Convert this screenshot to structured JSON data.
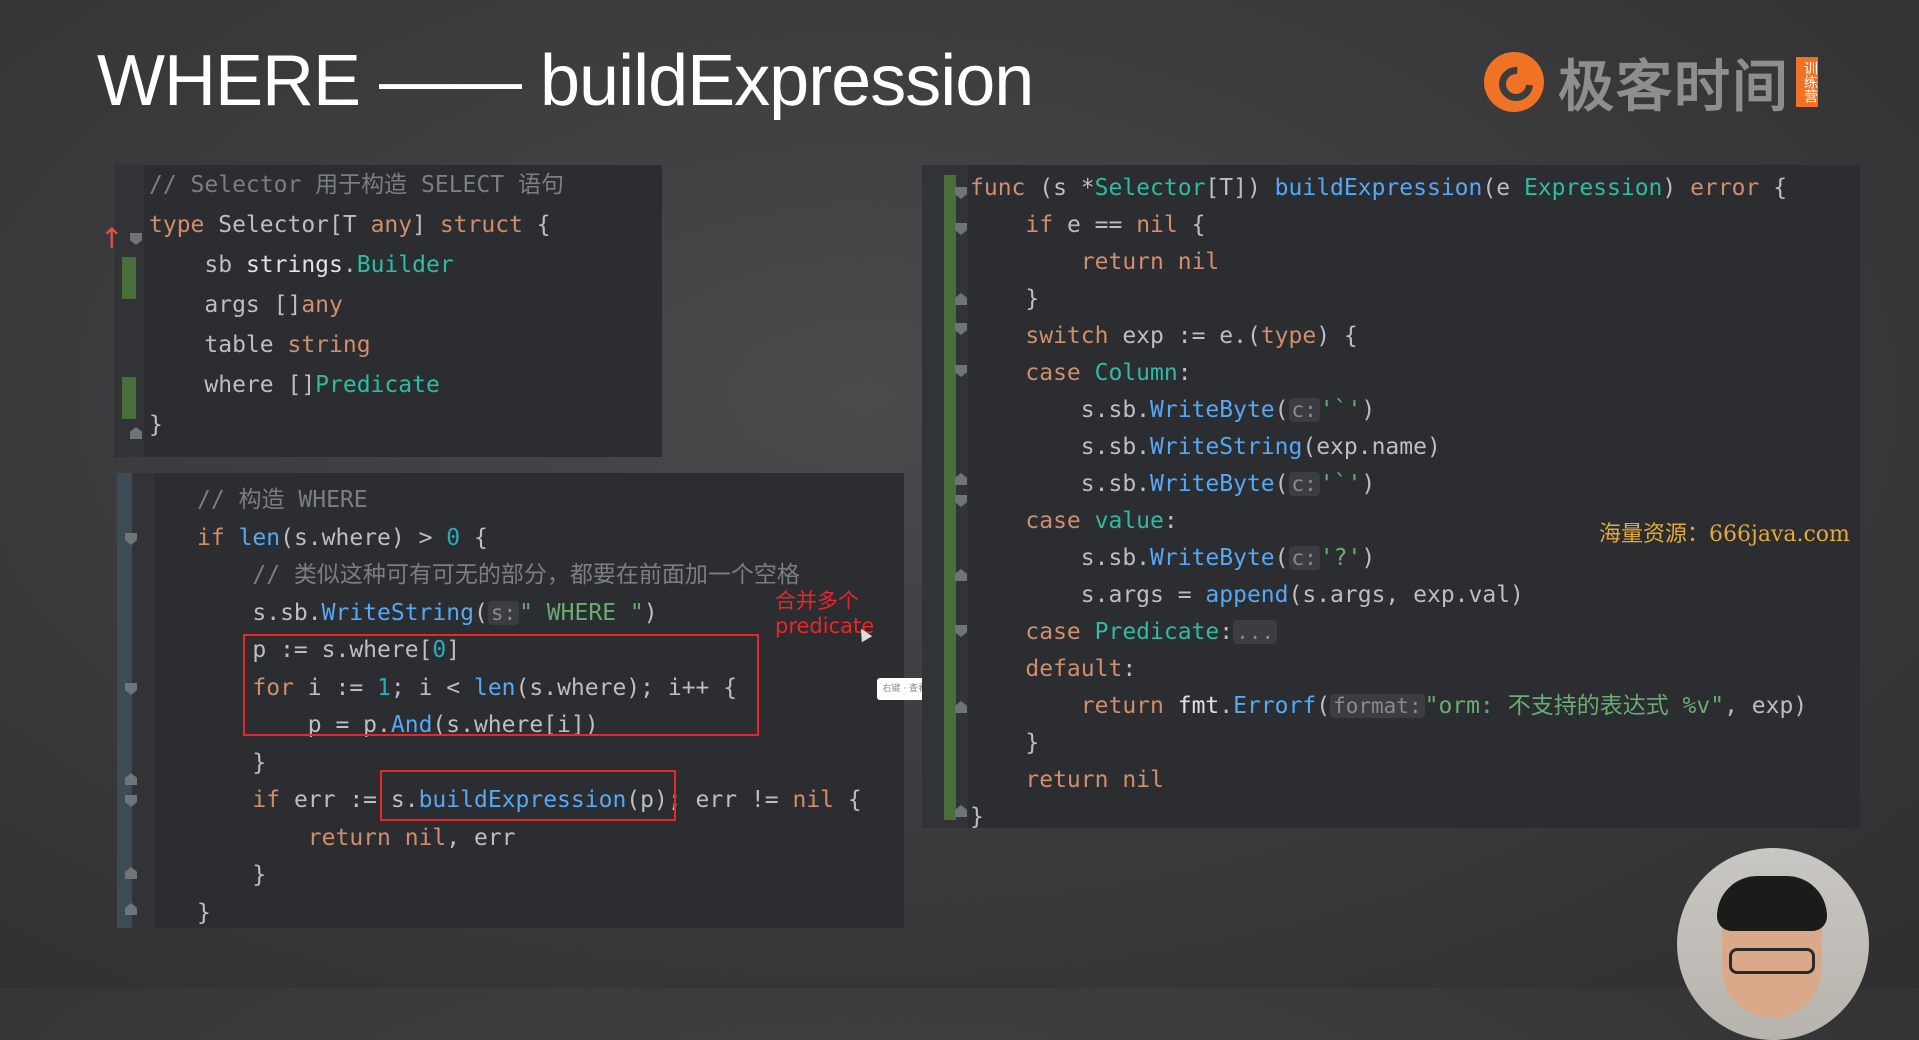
{
  "slide": {
    "title": "WHERE —— buildExpression"
  },
  "logo": {
    "text": "极客时间",
    "badge": "训练营"
  },
  "struct_panel": {
    "lines": [
      [
        {
          "t": "// Selector 用于构造 SELECT 语句",
          "c": "cmt"
        }
      ],
      [
        {
          "t": "type",
          "c": "kw"
        },
        {
          "t": " Selector[T "
        },
        {
          "t": "any",
          "c": "kw"
        },
        {
          "t": "] "
        },
        {
          "t": "struct",
          "c": "kw"
        },
        {
          "t": " {"
        }
      ],
      [
        {
          "t": "    sb "
        },
        {
          "t": "strings",
          "c": "pkg"
        },
        {
          "t": "."
        },
        {
          "t": "Builder",
          "c": "ty"
        }
      ],
      [
        {
          "t": "    args []"
        },
        {
          "t": "any",
          "c": "kw"
        }
      ],
      [
        {
          "t": "    table "
        },
        {
          "t": "string",
          "c": "kw"
        }
      ],
      [
        {
          "t": "    where []"
        },
        {
          "t": "Predicate",
          "c": "ty"
        }
      ],
      [
        {
          "t": "}"
        }
      ]
    ]
  },
  "where_panel": {
    "lines": [
      [
        {
          "t": "// 构造 WHERE",
          "c": "cmt"
        }
      ],
      [
        {
          "t": "if",
          "c": "kw"
        },
        {
          "t": " "
        },
        {
          "t": "len",
          "c": "fn"
        },
        {
          "t": "(s.where) > "
        },
        {
          "t": "0",
          "c": "num"
        },
        {
          "t": " {"
        }
      ],
      [
        {
          "t": "    "
        },
        {
          "t": "// 类似这种可有可无的部分，都要在前面加一个空格",
          "c": "cmt"
        }
      ],
      [
        {
          "t": "    s.sb."
        },
        {
          "t": "WriteString",
          "c": "fn"
        },
        {
          "t": "("
        },
        {
          "t": "s:",
          "c": "hint"
        },
        {
          "t": "\" WHERE \"",
          "c": "str"
        },
        {
          "t": ")"
        }
      ],
      [
        {
          "t": "    p := s.where["
        },
        {
          "t": "0",
          "c": "num"
        },
        {
          "t": "]"
        }
      ],
      [
        {
          "t": "    "
        },
        {
          "t": "for",
          "c": "kw"
        },
        {
          "t": " i := "
        },
        {
          "t": "1",
          "c": "num"
        },
        {
          "t": "; i < "
        },
        {
          "t": "len",
          "c": "fn"
        },
        {
          "t": "(s.where); i++ {"
        }
      ],
      [
        {
          "t": "        p = p."
        },
        {
          "t": "And",
          "c": "fn"
        },
        {
          "t": "(s.where[i])"
        }
      ],
      [
        {
          "t": "    }"
        }
      ],
      [
        {
          "t": "    "
        },
        {
          "t": "if",
          "c": "kw"
        },
        {
          "t": " err := s."
        },
        {
          "t": "buildExpression",
          "c": "fn"
        },
        {
          "t": "(p); err != "
        },
        {
          "t": "nil",
          "c": "kw"
        },
        {
          "t": " {"
        }
      ],
      [
        {
          "t": "        "
        },
        {
          "t": "return",
          "c": "kw"
        },
        {
          "t": " "
        },
        {
          "t": "nil",
          "c": "kw"
        },
        {
          "t": ", err"
        }
      ],
      [
        {
          "t": "    }"
        }
      ],
      [
        {
          "t": "}"
        }
      ]
    ],
    "note": [
      "合并多个",
      "predicate"
    ]
  },
  "build_panel": {
    "lines": [
      [
        {
          "t": "func",
          "c": "kw"
        },
        {
          "t": " (s *"
        },
        {
          "t": "Selector",
          "c": "ty"
        },
        {
          "t": "[T]) "
        },
        {
          "t": "buildExpression",
          "c": "fn"
        },
        {
          "t": "(e "
        },
        {
          "t": "Expression",
          "c": "ty"
        },
        {
          "t": ") "
        },
        {
          "t": "error",
          "c": "kw"
        },
        {
          "t": " {"
        }
      ],
      [
        {
          "t": "    "
        },
        {
          "t": "if",
          "c": "kw"
        },
        {
          "t": " e == "
        },
        {
          "t": "nil",
          "c": "kw"
        },
        {
          "t": " {"
        }
      ],
      [
        {
          "t": "        "
        },
        {
          "t": "return",
          "c": "kw"
        },
        {
          "t": " "
        },
        {
          "t": "nil",
          "c": "kw"
        }
      ],
      [
        {
          "t": "    }"
        }
      ],
      [
        {
          "t": "    "
        },
        {
          "t": "switch",
          "c": "kw"
        },
        {
          "t": " exp := e.("
        },
        {
          "t": "type",
          "c": "kw"
        },
        {
          "t": ") {"
        }
      ],
      [
        {
          "t": "    "
        },
        {
          "t": "case",
          "c": "kw"
        },
        {
          "t": " "
        },
        {
          "t": "Column",
          "c": "ty"
        },
        {
          "t": ":"
        }
      ],
      [
        {
          "t": "        s.sb."
        },
        {
          "t": "WriteByte",
          "c": "fn"
        },
        {
          "t": "("
        },
        {
          "t": "c:",
          "c": "hint"
        },
        {
          "t": "'`'",
          "c": "str"
        },
        {
          "t": ")"
        }
      ],
      [
        {
          "t": "        s.sb."
        },
        {
          "t": "WriteString",
          "c": "fn"
        },
        {
          "t": "(exp.name)"
        }
      ],
      [
        {
          "t": "        s.sb."
        },
        {
          "t": "WriteByte",
          "c": "fn"
        },
        {
          "t": "("
        },
        {
          "t": "c:",
          "c": "hint"
        },
        {
          "t": "'`'",
          "c": "str"
        },
        {
          "t": ")"
        }
      ],
      [
        {
          "t": "    "
        },
        {
          "t": "case",
          "c": "kw"
        },
        {
          "t": " "
        },
        {
          "t": "value",
          "c": "ty"
        },
        {
          "t": ":"
        }
      ],
      [
        {
          "t": "        s.sb."
        },
        {
          "t": "WriteByte",
          "c": "fn"
        },
        {
          "t": "("
        },
        {
          "t": "c:",
          "c": "hint"
        },
        {
          "t": "'?'",
          "c": "str"
        },
        {
          "t": ")"
        }
      ],
      [
        {
          "t": "        s.args = "
        },
        {
          "t": "append",
          "c": "fn"
        },
        {
          "t": "(s.args, exp.val)"
        }
      ],
      [
        {
          "t": "    "
        },
        {
          "t": "case",
          "c": "kw"
        },
        {
          "t": " "
        },
        {
          "t": "Predicate",
          "c": "ty"
        },
        {
          "t": ":"
        },
        {
          "t": "...",
          "c": "hint"
        }
      ],
      [
        {
          "t": "    "
        },
        {
          "t": "default",
          "c": "kw"
        },
        {
          "t": ":"
        }
      ],
      [
        {
          "t": "        "
        },
        {
          "t": "return",
          "c": "kw"
        },
        {
          "t": " "
        },
        {
          "t": "fmt",
          "c": "pkg"
        },
        {
          "t": "."
        },
        {
          "t": "Errorf",
          "c": "fn"
        },
        {
          "t": "("
        },
        {
          "t": "format:",
          "c": "hint"
        },
        {
          "t": "\"orm: 不支持的表达式 %v\"",
          "c": "str"
        },
        {
          "t": ", exp)"
        }
      ],
      [
        {
          "t": "    }"
        }
      ],
      [
        {
          "t": "    "
        },
        {
          "t": "return",
          "c": "kw"
        },
        {
          "t": " "
        },
        {
          "t": "nil",
          "c": "kw"
        }
      ],
      [
        {
          "t": "}"
        }
      ]
    ]
  },
  "watermark": "海量资源：666java.com",
  "tooltip": "右键 · 查看 · 跳转",
  "colors": {
    "annotation_red": "#e8262b",
    "brand_orange": "#f07325",
    "editor_bg": "#2b2d30"
  }
}
